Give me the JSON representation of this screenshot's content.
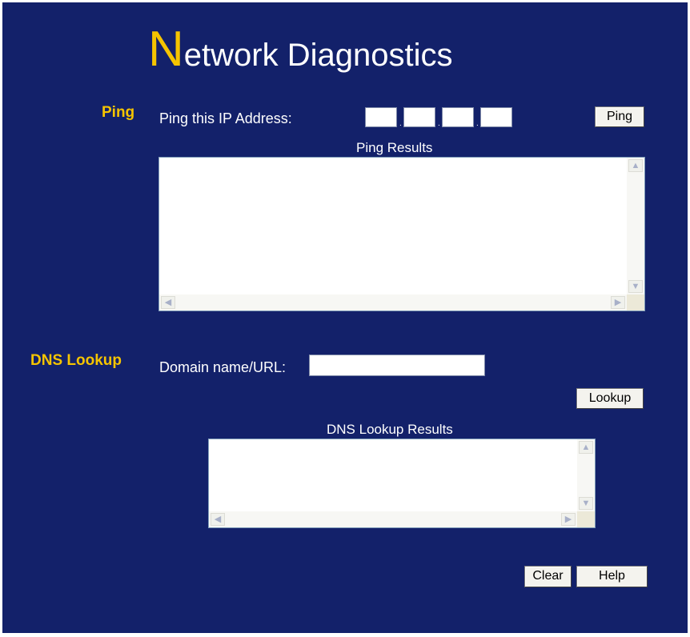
{
  "title": {
    "initial": "N",
    "rest": "etwork Diagnostics"
  },
  "ping": {
    "section_label": "Ping",
    "ip_label": "Ping this IP Address:",
    "ip_octets": [
      "",
      "",
      "",
      ""
    ],
    "button_label": "Ping",
    "results_label": "Ping Results",
    "results_text": ""
  },
  "dns": {
    "section_label": "DNS Lookup",
    "domain_label": "Domain name/URL:",
    "domain_value": "",
    "button_label": "Lookup",
    "results_label": "DNS Lookup Results",
    "results_text": ""
  },
  "footer": {
    "clear_label": "Clear",
    "help_label": "Help"
  },
  "colors": {
    "background": "#13216a",
    "accent": "#f5c400",
    "text": "#ffffff"
  }
}
